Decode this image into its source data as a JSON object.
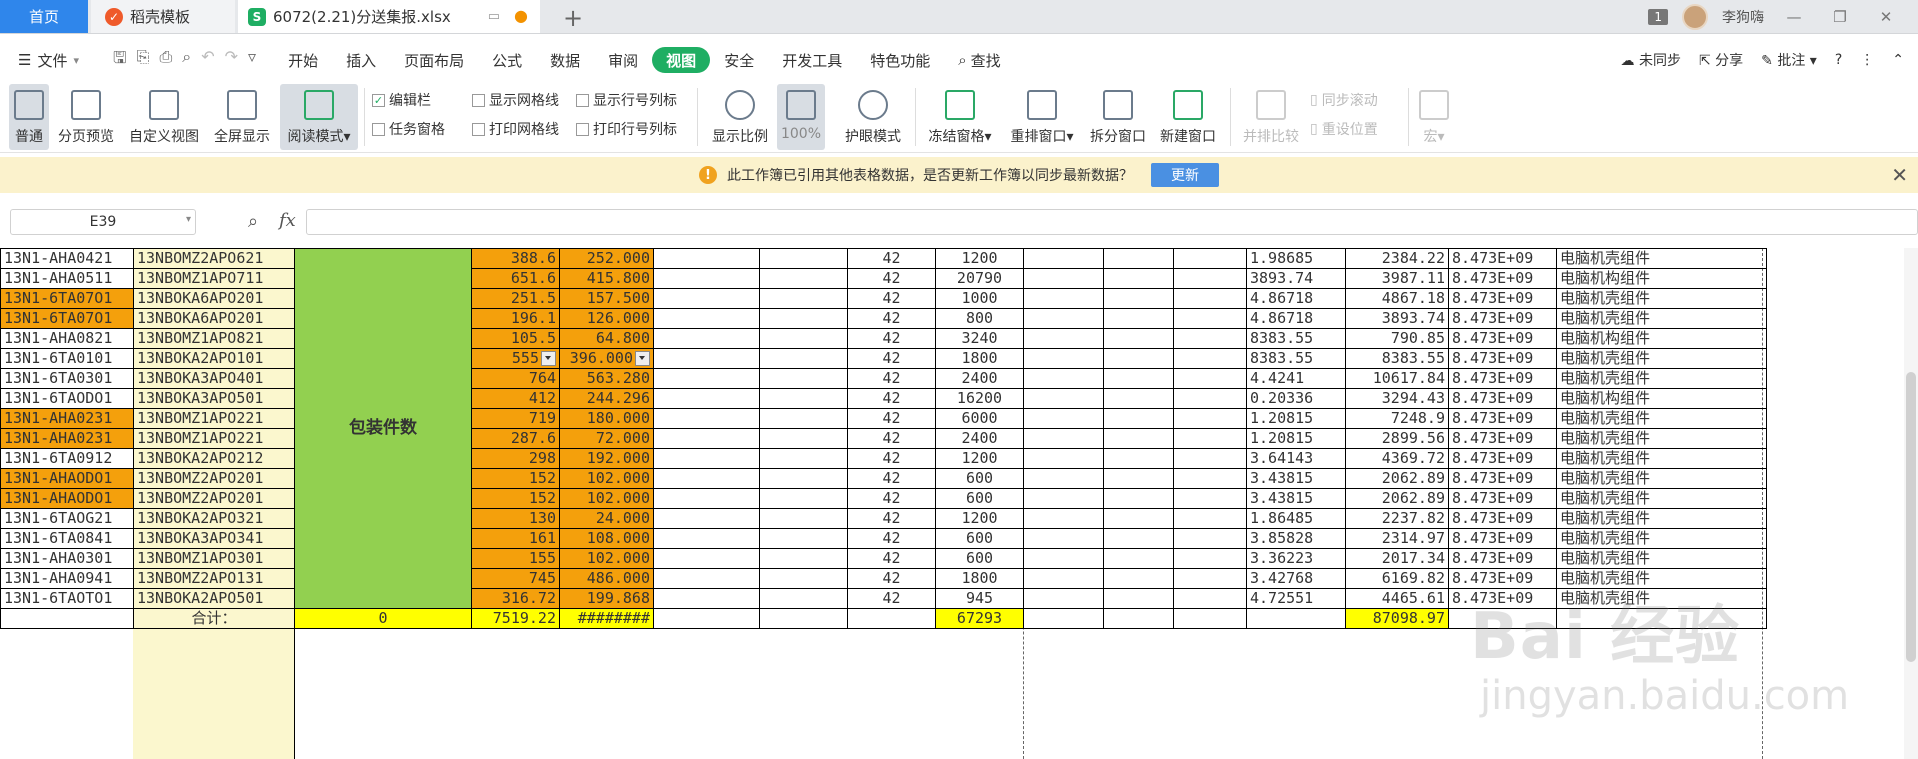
{
  "tabs": {
    "home": "首页",
    "template": "稻壳模板",
    "file": "6072(2.21)分送集报.xlsx"
  },
  "window": {
    "badge": "1",
    "user": "李狗嗨"
  },
  "menu": {
    "file": "文件",
    "items": [
      "开始",
      "插入",
      "页面布局",
      "公式",
      "数据",
      "审阅",
      "视图",
      "安全",
      "开发工具",
      "特色功能"
    ],
    "active": "视图",
    "search": "查找",
    "sync": "未同步",
    "share": "分享",
    "annotate": "批注"
  },
  "ribbon": {
    "normal": "普通",
    "page_preview": "分页预览",
    "custom_view": "自定义视图",
    "fullscreen": "全屏显示",
    "read_mode": "阅读模式",
    "formula_bar": "编辑栏",
    "task_pane": "任务窗格",
    "show_gridlines": "显示网格线",
    "print_gridlines": "打印网格线",
    "show_headers": "显示行号列标",
    "print_headers": "打印行号列标",
    "zoom": "显示比例",
    "zoom100": "100%",
    "eye_mode": "护眼模式",
    "freeze": "冻结窗格",
    "rearrange": "重排窗口",
    "split": "拆分窗口",
    "new_window": "新建窗口",
    "side_by_side": "并排比较",
    "sync_scroll": "同步滚动",
    "reset_pos": "重设位置",
    "macro": "宏",
    "formula_bar_checked": true
  },
  "notification": {
    "text": "此工作簿已引用其他表格数据，是否更新工作簿以同步最新数据？",
    "button": "更新"
  },
  "formula": {
    "cell": "E39",
    "fx": "fx",
    "value": ""
  },
  "sheet": {
    "merged_label": "包装件数",
    "rows": [
      {
        "a": "13N1-AHA0421",
        "b": "13NBOMZ2APO621",
        "e": "388.6",
        "f": "252.000",
        "h": "42",
        "i": "1200",
        "m": "1.98685",
        "n": "2384.22",
        "o": "8.473E+09",
        "p": "电脑机壳组件",
        "a_orange": false
      },
      {
        "a": "13N1-AHA0511",
        "b": "13NBOMZ1APO711",
        "e": "651.6",
        "f": "415.800",
        "h": "42",
        "i": "20790",
        "m": "3893.74",
        "n": "3987.11",
        "o": "8.473E+09",
        "p": "电脑机构组件",
        "a_orange": false
      },
      {
        "a": "13N1-6TA07O1",
        "b": "13NBOKA6APO201",
        "e": "251.5",
        "f": "157.500",
        "h": "42",
        "i": "1000",
        "m": "4.86718",
        "n": "4867.18",
        "o": "8.473E+09",
        "p": "电脑机壳组件",
        "a_orange": true
      },
      {
        "a": "13N1-6TA07O1",
        "b": "13NBOKA6APO201",
        "e": "196.1",
        "f": "126.000",
        "h": "42",
        "i": "800",
        "m": "4.86718",
        "n": "3893.74",
        "o": "8.473E+09",
        "p": "电脑机壳组件",
        "a_orange": true
      },
      {
        "a": "13N1-AHA0821",
        "b": "13NBOMZ1APO821",
        "e": "105.5",
        "f": "64.800",
        "h": "42",
        "i": "3240",
        "m": "8383.55",
        "n": "790.85",
        "o": "8.473E+09",
        "p": "电脑机构组件",
        "a_orange": false
      },
      {
        "a": "13N1-6TA0101",
        "b": "13NBOKA2APO101",
        "e": "555",
        "f": "396.000",
        "h": "42",
        "i": "1800",
        "m": "8383.55",
        "n": "8383.55",
        "o": "8.473E+09",
        "p": "电脑机壳组件",
        "a_orange": false
      },
      {
        "a": "13N1-6TA0301",
        "b": "13NBOKA3APO401",
        "e": "764",
        "f": "563.280",
        "h": "42",
        "i": "2400",
        "m": "4.4241",
        "n": "10617.84",
        "o": "8.473E+09",
        "p": "电脑机壳组件",
        "a_orange": false
      },
      {
        "a": "13N1-6TAODO1",
        "b": "13NBOKA3APO501",
        "e": "412",
        "f": "244.296",
        "h": "42",
        "i": "16200",
        "m": "0.20336",
        "n": "3294.43",
        "o": "8.473E+09",
        "p": "电脑机构组件",
        "a_orange": false
      },
      {
        "a": "13N1-AHA0231",
        "b": "13NBOMZ1APO221",
        "e": "719",
        "f": "180.000",
        "h": "42",
        "i": "6000",
        "m": "1.20815",
        "n": "7248.9",
        "o": "8.473E+09",
        "p": "电脑机壳组件",
        "a_orange": true
      },
      {
        "a": "13N1-AHA0231",
        "b": "13NBOMZ1APO221",
        "e": "287.6",
        "f": "72.000",
        "h": "42",
        "i": "2400",
        "m": "1.20815",
        "n": "2899.56",
        "o": "8.473E+09",
        "p": "电脑机壳组件",
        "a_orange": true
      },
      {
        "a": "13N1-6TA0912",
        "b": "13NBOKA2APO212",
        "e": "298",
        "f": "192.000",
        "h": "42",
        "i": "1200",
        "m": "3.64143",
        "n": "4369.72",
        "o": "8.473E+09",
        "p": "电脑机壳组件",
        "a_orange": false
      },
      {
        "a": "13N1-AHAODO1",
        "b": "13NBOMZ2APO201",
        "e": "152",
        "f": "102.000",
        "h": "42",
        "i": "600",
        "m": "3.43815",
        "n": "2062.89",
        "o": "8.473E+09",
        "p": "电脑机壳组件",
        "a_orange": true
      },
      {
        "a": "13N1-AHAODO1",
        "b": "13NBOMZ2APO201",
        "e": "152",
        "f": "102.000",
        "h": "42",
        "i": "600",
        "m": "3.43815",
        "n": "2062.89",
        "o": "8.473E+09",
        "p": "电脑机壳组件",
        "a_orange": true
      },
      {
        "a": "13N1-6TAOG21",
        "b": "13NBOKA2APO321",
        "e": "130",
        "f": "24.000",
        "h": "42",
        "i": "1200",
        "m": "1.86485",
        "n": "2237.82",
        "o": "8.473E+09",
        "p": "电脑机壳组件",
        "a_orange": false
      },
      {
        "a": "13N1-6TA0841",
        "b": "13NBOKA3APO341",
        "e": "161",
        "f": "108.000",
        "h": "42",
        "i": "600",
        "m": "3.85828",
        "n": "2314.97",
        "o": "8.473E+09",
        "p": "电脑机壳组件",
        "a_orange": false
      },
      {
        "a": "13N1-AHA0301",
        "b": "13NBOMZ1APO301",
        "e": "155",
        "f": "102.000",
        "h": "42",
        "i": "600",
        "m": "3.36223",
        "n": "2017.34",
        "o": "8.473E+09",
        "p": "电脑机壳组件",
        "a_orange": false
      },
      {
        "a": "13N1-AHA0941",
        "b": "13NBOMZ2APO131",
        "e": "745",
        "f": "486.000",
        "h": "42",
        "i": "1800",
        "m": "3.42768",
        "n": "6169.82",
        "o": "8.473E+09",
        "p": "电脑机壳组件",
        "a_orange": false
      },
      {
        "a": "13N1-6TAOTO1",
        "b": "13NBOKA2APO501",
        "e": "316.72",
        "f": "199.868",
        "h": "42",
        "i": "945",
        "m": "4.72551",
        "n": "4465.61",
        "o": "8.473E+09",
        "p": "电脑机壳组件",
        "a_orange": false
      }
    ],
    "total": {
      "label": "合计：",
      "c": "0",
      "e": "7519.22",
      "f": "########",
      "i": "67293",
      "n": "87098.97"
    }
  },
  "watermark": {
    "main": "Bai 经验",
    "sub": "jingyan.baidu.com"
  },
  "colors": {
    "orange": "#f4a00c",
    "cream": "#fbf7ce",
    "green": "#92d050",
    "yellow": "#ffff00",
    "wps_green": "#1fae63",
    "tab_blue": "#2f86eb"
  }
}
